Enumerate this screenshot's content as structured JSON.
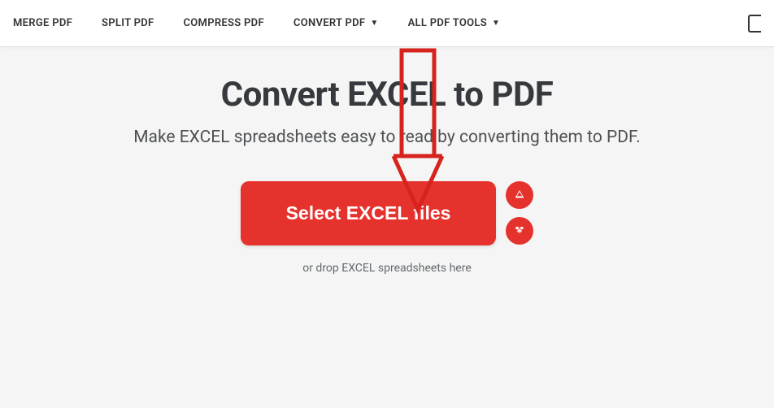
{
  "nav": {
    "items": [
      {
        "label": "MERGE PDF",
        "hasDropdown": false
      },
      {
        "label": "SPLIT PDF",
        "hasDropdown": false
      },
      {
        "label": "COMPRESS PDF",
        "hasDropdown": false
      },
      {
        "label": "CONVERT PDF",
        "hasDropdown": true
      },
      {
        "label": "ALL PDF TOOLS",
        "hasDropdown": true
      }
    ]
  },
  "main": {
    "title": "Convert EXCEL to PDF",
    "subtitle": "Make EXCEL spreadsheets easy to read by converting them to PDF.",
    "selectButton": "Select EXCEL files",
    "dropText": "or drop EXCEL spreadsheets here"
  },
  "colors": {
    "accent": "#e5322d",
    "annotation": "#d6231e"
  }
}
